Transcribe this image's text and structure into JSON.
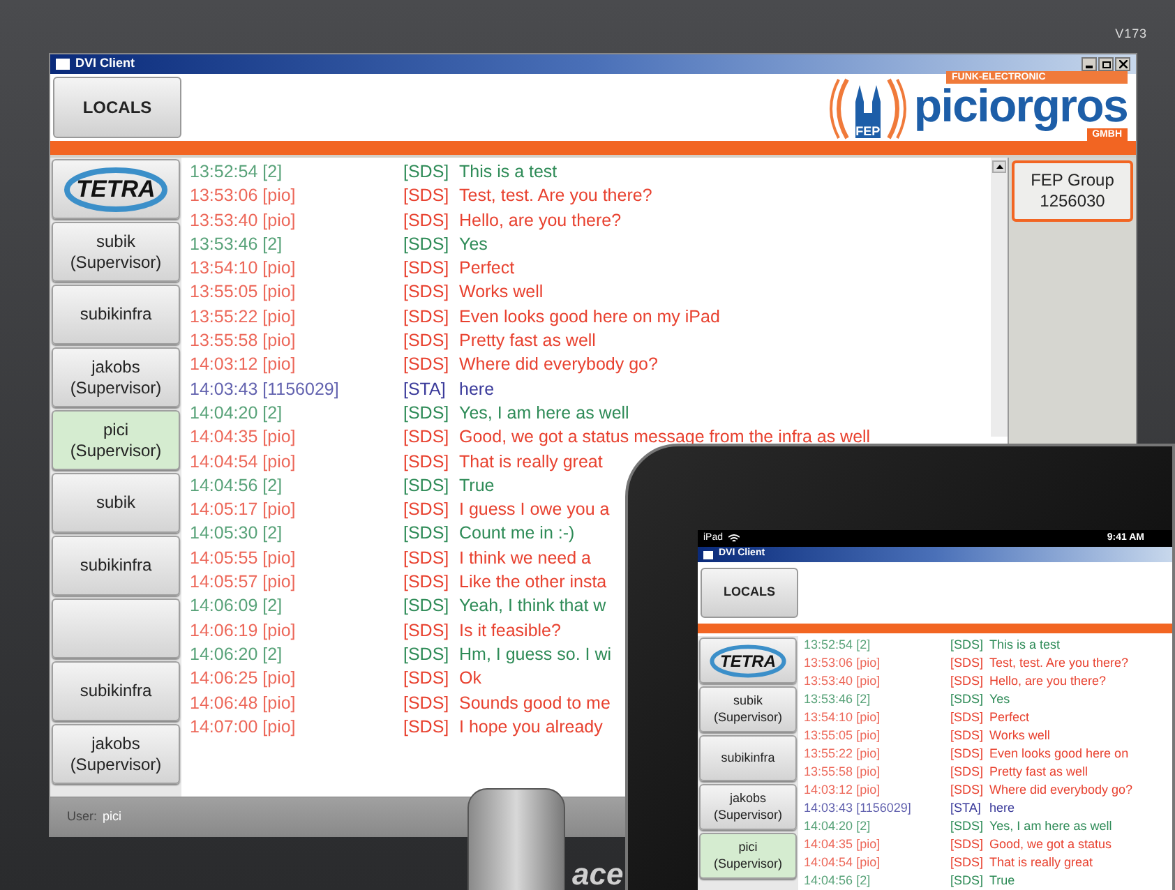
{
  "monitor": {
    "model": "V173",
    "brand": "ace"
  },
  "window": {
    "title": "DVI Client"
  },
  "header": {
    "locals_button": "LOCALS",
    "logo": {
      "tagline": "FUNK-ELECTRONIC",
      "name": "piciorgros",
      "suffix": "GMBH",
      "badge": "FEP"
    }
  },
  "contacts": [
    {
      "kind": "logo",
      "label": "TETRA",
      "selected": false
    },
    {
      "kind": "user",
      "name": "subik",
      "role": "(Supervisor)",
      "selected": false
    },
    {
      "kind": "user",
      "name": "subikinfra",
      "selected": false
    },
    {
      "kind": "user",
      "name": "jakobs",
      "role": "(Supervisor)",
      "selected": false
    },
    {
      "kind": "user",
      "name": "pici",
      "role": "(Supervisor)",
      "selected": true
    },
    {
      "kind": "user",
      "name": "subik",
      "selected": false
    },
    {
      "kind": "user",
      "name": "subikinfra",
      "selected": false
    },
    {
      "kind": "blank",
      "selected": false
    },
    {
      "kind": "user",
      "name": "subikinfra",
      "selected": false
    },
    {
      "kind": "user",
      "name": "jakobs",
      "role": "(Supervisor)",
      "selected": false
    }
  ],
  "messages": [
    {
      "time": "13:52:54",
      "sender": "[2]",
      "tag": "[SDS]",
      "text": "This is a test",
      "color": "#2e8b57"
    },
    {
      "time": "13:53:06",
      "sender": "[pio]",
      "tag": "[SDS]",
      "text": "Test, test. Are you there?",
      "color": "#e8412f"
    },
    {
      "time": "13:53:40",
      "sender": "[pio]",
      "tag": "[SDS]",
      "text": "Hello, are you there?",
      "color": "#e8412f"
    },
    {
      "time": "13:53:46",
      "sender": "[2]",
      "tag": "[SDS]",
      "text": "Yes",
      "color": "#2e8b57"
    },
    {
      "time": "13:54:10",
      "sender": "[pio]",
      "tag": "[SDS]",
      "text": "Perfect",
      "color": "#e8412f"
    },
    {
      "time": "13:55:05",
      "sender": "[pio]",
      "tag": "[SDS]",
      "text": "Works well",
      "color": "#e8412f"
    },
    {
      "time": "13:55:22",
      "sender": "[pio]",
      "tag": "[SDS]",
      "text": "Even looks good here on my iPad",
      "color": "#e8412f"
    },
    {
      "time": "13:55:58",
      "sender": "[pio]",
      "tag": "[SDS]",
      "text": "Pretty fast as well",
      "color": "#e8412f"
    },
    {
      "time": "14:03:12",
      "sender": "[pio]",
      "tag": "[SDS]",
      "text": "Where did everybody go?",
      "color": "#e8412f"
    },
    {
      "time": "14:03:43",
      "sender": "[1156029]",
      "tag": "[STA]",
      "text": "here",
      "color": "#3a3a9a"
    },
    {
      "time": "14:04:20",
      "sender": "[2]",
      "tag": "[SDS]",
      "text": "Yes, I am here as well",
      "color": "#2e8b57"
    },
    {
      "time": "14:04:35",
      "sender": "[pio]",
      "tag": "[SDS]",
      "text": "Good, we got a status message from the infra as well",
      "color": "#e8412f"
    },
    {
      "time": "14:04:54",
      "sender": "[pio]",
      "tag": "[SDS]",
      "text": "That is really great",
      "color": "#e8412f"
    },
    {
      "time": "14:04:56",
      "sender": "[2]",
      "tag": "[SDS]",
      "text": "True",
      "color": "#2e8b57"
    },
    {
      "time": "14:05:17",
      "sender": "[pio]",
      "tag": "[SDS]",
      "text": "I guess I owe you a",
      "color": "#e8412f"
    },
    {
      "time": "14:05:30",
      "sender": "[2]",
      "tag": "[SDS]",
      "text": "Count me in :-)",
      "color": "#2e8b57"
    },
    {
      "time": "14:05:55",
      "sender": "[pio]",
      "tag": "[SDS]",
      "text": "I think we need a",
      "color": "#e8412f"
    },
    {
      "time": "14:05:57",
      "sender": "[pio]",
      "tag": "[SDS]",
      "text": "Like the other insta",
      "color": "#e8412f"
    },
    {
      "time": "14:06:09",
      "sender": "[2]",
      "tag": "[SDS]",
      "text": "Yeah, I think that w",
      "color": "#2e8b57"
    },
    {
      "time": "14:06:19",
      "sender": "[pio]",
      "tag": "[SDS]",
      "text": "Is it feasible?",
      "color": "#e8412f"
    },
    {
      "time": "14:06:20",
      "sender": "[2]",
      "tag": "[SDS]",
      "text": "Hm, I guess so. I wi",
      "color": "#2e8b57"
    },
    {
      "time": "14:06:25",
      "sender": "[pio]",
      "tag": "[SDS]",
      "text": "Ok",
      "color": "#e8412f"
    },
    {
      "time": "14:06:48",
      "sender": "[pio]",
      "tag": "[SDS]",
      "text": "Sounds good to me",
      "color": "#e8412f"
    },
    {
      "time": "14:07:00",
      "sender": "[pio]",
      "tag": "[SDS]",
      "text": "I hope you already",
      "color": "#e8412f"
    }
  ],
  "group_button": {
    "name": "FEP Group",
    "number": "1256030"
  },
  "status_bar": {
    "label": "User:",
    "user": "pici"
  },
  "tablet": {
    "status": {
      "device": "iPad",
      "time": "9:41 AM"
    },
    "window": {
      "title": "DVI Client"
    },
    "locals_button": "LOCALS",
    "contacts": [
      {
        "kind": "logo",
        "label": "TETRA",
        "selected": false
      },
      {
        "kind": "user",
        "name": "subik",
        "role": "(Supervisor)",
        "selected": false
      },
      {
        "kind": "user",
        "name": "subikinfra",
        "selected": false
      },
      {
        "kind": "user",
        "name": "jakobs",
        "role": "(Supervisor)",
        "selected": false
      },
      {
        "kind": "user",
        "name": "pici",
        "role": "(Supervisor)",
        "selected": true
      }
    ],
    "messages": [
      {
        "time": "13:52:54",
        "sender": "[2]",
        "tag": "[SDS]",
        "text": "This is a test",
        "color": "#2e8b57"
      },
      {
        "time": "13:53:06",
        "sender": "[pio]",
        "tag": "[SDS]",
        "text": "Test, test. Are you there?",
        "color": "#e8412f"
      },
      {
        "time": "13:53:40",
        "sender": "[pio]",
        "tag": "[SDS]",
        "text": "Hello, are you there?",
        "color": "#e8412f"
      },
      {
        "time": "13:53:46",
        "sender": "[2]",
        "tag": "[SDS]",
        "text": "Yes",
        "color": "#2e8b57"
      },
      {
        "time": "13:54:10",
        "sender": "[pio]",
        "tag": "[SDS]",
        "text": "Perfect",
        "color": "#e8412f"
      },
      {
        "time": "13:55:05",
        "sender": "[pio]",
        "tag": "[SDS]",
        "text": "Works well",
        "color": "#e8412f"
      },
      {
        "time": "13:55:22",
        "sender": "[pio]",
        "tag": "[SDS]",
        "text": "Even looks good here on",
        "color": "#e8412f"
      },
      {
        "time": "13:55:58",
        "sender": "[pio]",
        "tag": "[SDS]",
        "text": "Pretty fast as well",
        "color": "#e8412f"
      },
      {
        "time": "14:03:12",
        "sender": "[pio]",
        "tag": "[SDS]",
        "text": "Where did everybody go?",
        "color": "#e8412f"
      },
      {
        "time": "14:03:43",
        "sender": "[1156029]",
        "tag": "[STA]",
        "text": "here",
        "color": "#3a3a9a"
      },
      {
        "time": "14:04:20",
        "sender": "[2]",
        "tag": "[SDS]",
        "text": "Yes, I am here as well",
        "color": "#2e8b57"
      },
      {
        "time": "14:04:35",
        "sender": "[pio]",
        "tag": "[SDS]",
        "text": "Good, we got a status",
        "color": "#e8412f"
      },
      {
        "time": "14:04:54",
        "sender": "[pio]",
        "tag": "[SDS]",
        "text": "That is really great",
        "color": "#e8412f"
      },
      {
        "time": "14:04:56",
        "sender": "[2]",
        "tag": "[SDS]",
        "text": "True",
        "color": "#2e8b57"
      }
    ]
  }
}
